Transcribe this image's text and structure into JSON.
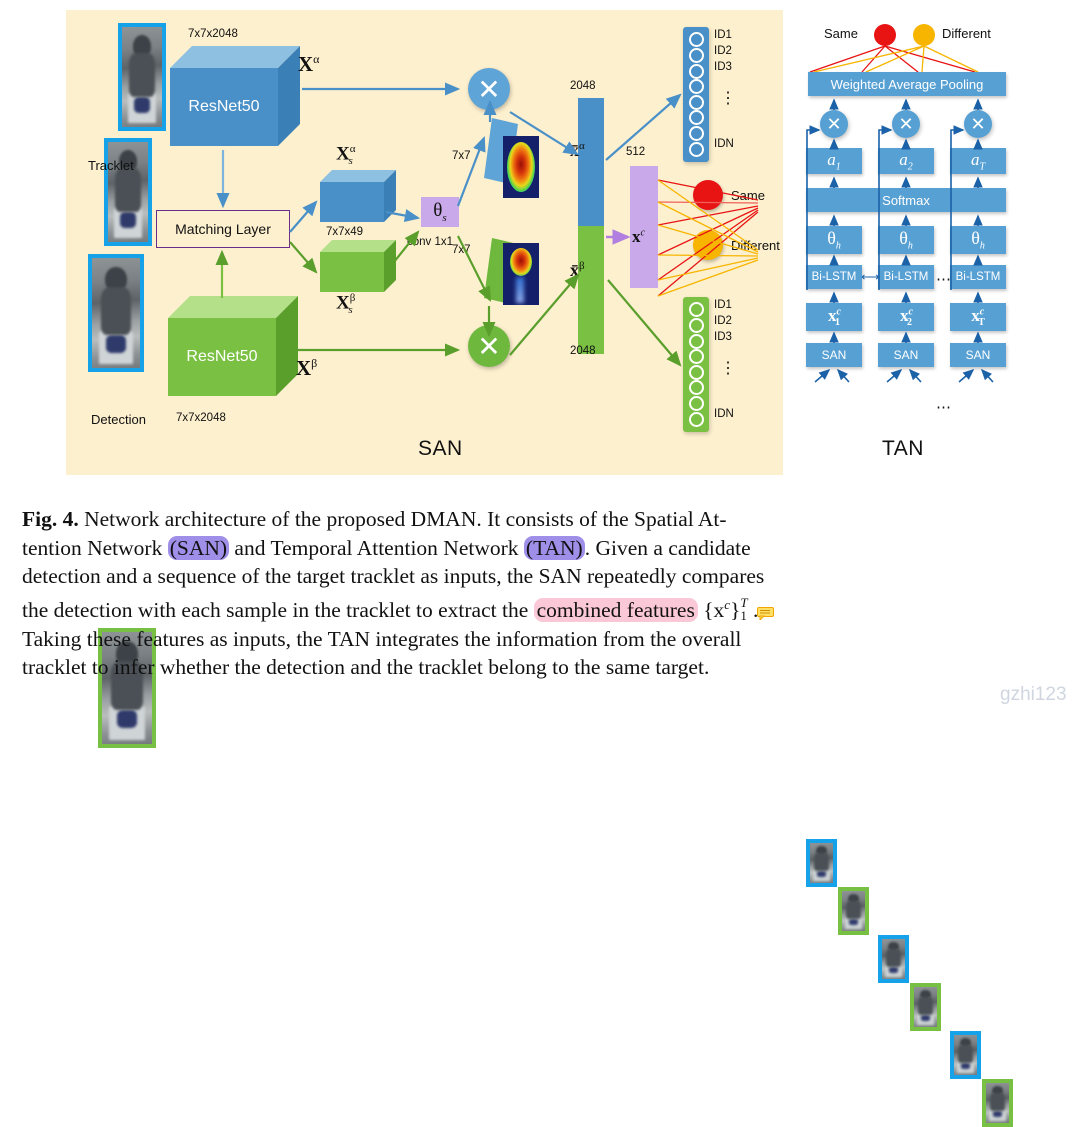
{
  "figure": {
    "panels": {
      "san": {
        "title": "SAN",
        "bg": "#fdf0ce"
      },
      "tan": {
        "title": "TAN",
        "bg": "#e9eeda"
      }
    },
    "colors": {
      "blue": "#4a90c8",
      "blue_light": "#7fb5dd",
      "green": "#7ac143",
      "green_light": "#a8d96f",
      "purple": "#c9a9e9",
      "purple_border": "#6b2d8c",
      "red": "#e81414",
      "orange": "#f7b500",
      "tan_bg": "#e9eeda",
      "san_bg": "#fdf0ce"
    },
    "san": {
      "tracklet_label": "Tracklet",
      "detection_label": "Detection",
      "resnet_top": "ResNet50",
      "resnet_bottom": "ResNet50",
      "dim_top": "7x7x2048",
      "dim_bottom": "7x7x2048",
      "x_alpha": "X",
      "x_alpha_sup": "α",
      "x_beta": "X",
      "x_beta_sup": "β",
      "matching_layer": "Matching Layer",
      "xs_alpha": "X",
      "xs_alpha_sup": "α",
      "xs_alpha_sub": "s",
      "xs_beta": "X",
      "xs_beta_sup": "β",
      "xs_beta_sub": "s",
      "dim_matched": "7x7x49",
      "theta_s": "θ",
      "theta_s_sub": "s",
      "conv_label": "conv 1x1",
      "attn_top_dim": "7x7",
      "attn_bottom_dim": "7x7",
      "mul_symbol": "✕",
      "feat_top_dim": "2048",
      "feat_bottom_dim": "2048",
      "xbar_alpha": "x̄",
      "xbar_alpha_sup": "α",
      "xbar_beta": "x̄",
      "xbar_beta_sup": "β",
      "xc_dim": "512",
      "xc": "x",
      "xc_sup": "c",
      "id_labels_top": [
        "ID1",
        "ID2",
        "ID3"
      ],
      "id_dots_top": "⋮",
      "id_last_top": "IDN",
      "id_labels_bottom": [
        "ID1",
        "ID2",
        "ID3"
      ],
      "id_dots_bottom": "⋮",
      "id_last_bottom": "IDN",
      "class_same": "Same",
      "class_different": "Different"
    },
    "tan": {
      "same": "Same",
      "different": "Different",
      "weighted_avg_pooling": "Weighted Average Pooling",
      "attention_weights": [
        "a",
        "a",
        "a"
      ],
      "attention_subs": [
        "1",
        "2",
        "T"
      ],
      "softmax": "Softmax",
      "theta_h": [
        "θ",
        "θ",
        "θ"
      ],
      "theta_h_sub": "h",
      "bilstm": [
        "Bi-LSTM",
        "Bi-LSTM",
        "Bi-LSTM"
      ],
      "bilstm_dots": "⋯",
      "xc_boxes": [
        "x",
        "x",
        "x"
      ],
      "xc_sup": "c",
      "xc_subs": [
        "1",
        "2",
        "T"
      ],
      "san_boxes": [
        "SAN",
        "SAN",
        "SAN"
      ],
      "input_dots": "⋯",
      "mul_symbol": "✕",
      "link_arrow": "⟷"
    }
  },
  "caption": {
    "lines": [
      [
        {
          "t": "Fig. 4.",
          "style": "bold"
        },
        {
          "t": " Network architecture of the proposed DMAN. It consists of the Spatial At-",
          "style": "plain"
        }
      ],
      [
        {
          "t": "tention Network ",
          "style": "plain"
        },
        {
          "t": "(SAN)",
          "style": "hl-purple"
        },
        {
          "t": " and Temporal Attention Network ",
          "style": "plain"
        },
        {
          "t": "(TAN)",
          "style": "hl-purple"
        },
        {
          "t": ". Given a candidate",
          "style": "plain"
        }
      ],
      [
        {
          "t": "detection and a sequence of the target tracklet as inputs, the SAN repeatedly compares",
          "style": "plain"
        }
      ],
      [
        {
          "t": "the detection with each sample in the tracklet to extract the ",
          "style": "plain"
        },
        {
          "t": "combined features",
          "style": "hl-pink"
        },
        {
          "t": " {x",
          "style": "plain"
        },
        {
          "t": "c",
          "style": "sup"
        },
        {
          "t": "}",
          "style": "plain"
        },
        {
          "t": "T",
          "style": "supsub-T"
        },
        {
          "t": "1",
          "style": "supsub-1"
        },
        {
          "t": " .",
          "style": "plain"
        }
      ],
      [
        {
          "t": "Taking these features as inputs, the TAN integrates the information from the overall",
          "style": "plain"
        }
      ],
      [
        {
          "t": "tracklet to infer whether the detection and the tracklet belong to the same target.",
          "style": "plain"
        }
      ]
    ],
    "watermark": "gzhi123"
  }
}
